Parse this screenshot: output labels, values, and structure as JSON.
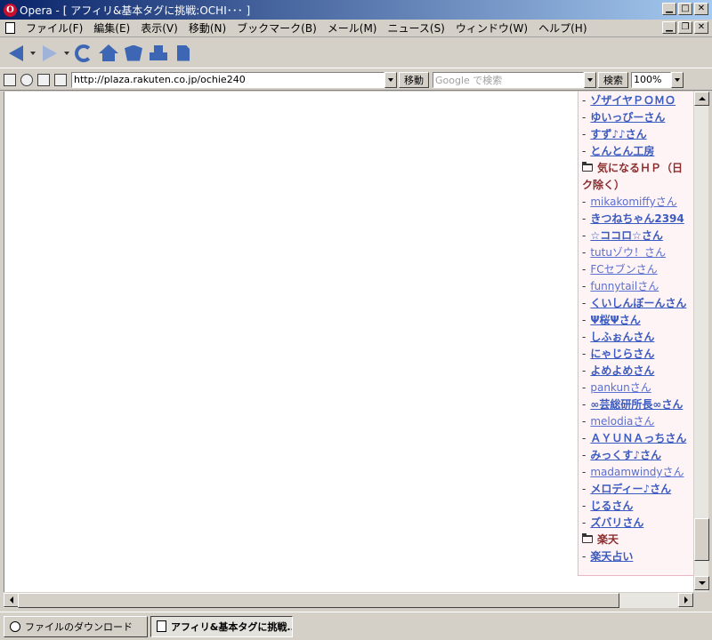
{
  "window": {
    "title": "Opera - [ アフィリ&基本タグに挑戦:OCHI･･･ ]",
    "logo_letter": "O"
  },
  "menu": [
    "ファイル(F)",
    "編集(E)",
    "表示(V)",
    "移動(N)",
    "ブックマーク(B)",
    "メール(M)",
    "ニュース(S)",
    "ウィンドウ(W)",
    "ヘルプ(H)"
  ],
  "address": {
    "url": "http://plaza.rakuten.co.jp/ochie240",
    "go_label": "移動",
    "search_placeholder": "Google で検索",
    "search_label": "検索",
    "zoom": "100%"
  },
  "sidebar": {
    "rows": [
      {
        "type": "link",
        "text": "ゾザイヤＰＯＭＯ",
        "weight": "bold"
      },
      {
        "type": "link",
        "text": "ゆいっぴーさん",
        "weight": "bold"
      },
      {
        "type": "link",
        "text": "すず♪♪さん",
        "weight": "bold"
      },
      {
        "type": "link",
        "text": "とんとん工房",
        "weight": "bold"
      },
      {
        "type": "category",
        "text": "気になるＨＰ（日"
      },
      {
        "type": "cont",
        "text": "ク除く）"
      },
      {
        "type": "link",
        "text": "mikakomiffyさん",
        "weight": "normal"
      },
      {
        "type": "link",
        "text": "きつねちゃん2394",
        "weight": "bold"
      },
      {
        "type": "link",
        "text": "☆ココロ☆さん",
        "weight": "bold"
      },
      {
        "type": "link",
        "text": "tutuゾウ！さん",
        "weight": "normal"
      },
      {
        "type": "link",
        "text": "FCセブンさん",
        "weight": "normal"
      },
      {
        "type": "link",
        "text": "funnytailさん",
        "weight": "normal"
      },
      {
        "type": "link",
        "text": "くいしんぼーんさん",
        "weight": "bold"
      },
      {
        "type": "link",
        "text": "Ψ桜Ψさん",
        "weight": "bold"
      },
      {
        "type": "link",
        "text": "しふぉんさん",
        "weight": "bold"
      },
      {
        "type": "link",
        "text": "にゃじらさん",
        "weight": "bold"
      },
      {
        "type": "link",
        "text": "よめよめさん",
        "weight": "bold"
      },
      {
        "type": "link",
        "text": "pankunさん",
        "weight": "normal"
      },
      {
        "type": "link",
        "text": "∞芸総研所長∞さん",
        "weight": "bold"
      },
      {
        "type": "link",
        "text": "melodiaさん",
        "weight": "normal"
      },
      {
        "type": "link",
        "text": "ＡＹＵＮＡっちさん",
        "weight": "bold"
      },
      {
        "type": "link",
        "text": "みっくす♪さん",
        "weight": "bold"
      },
      {
        "type": "link",
        "text": "madamwindyさん",
        "weight": "normal"
      },
      {
        "type": "link",
        "text": "メロディー♪さん",
        "weight": "bold"
      },
      {
        "type": "link",
        "text": "じるさん",
        "weight": "bold"
      },
      {
        "type": "link",
        "text": "ズバリさん",
        "weight": "bold"
      },
      {
        "type": "category",
        "text": "楽天"
      },
      {
        "type": "link",
        "text": "楽天占い",
        "weight": "bold"
      }
    ]
  },
  "pagebar": {
    "tabs": [
      {
        "label": "ファイルのダウンロード",
        "active": false
      },
      {
        "label": "アフィリ&基本タグに挑戦...",
        "active": true
      }
    ]
  }
}
